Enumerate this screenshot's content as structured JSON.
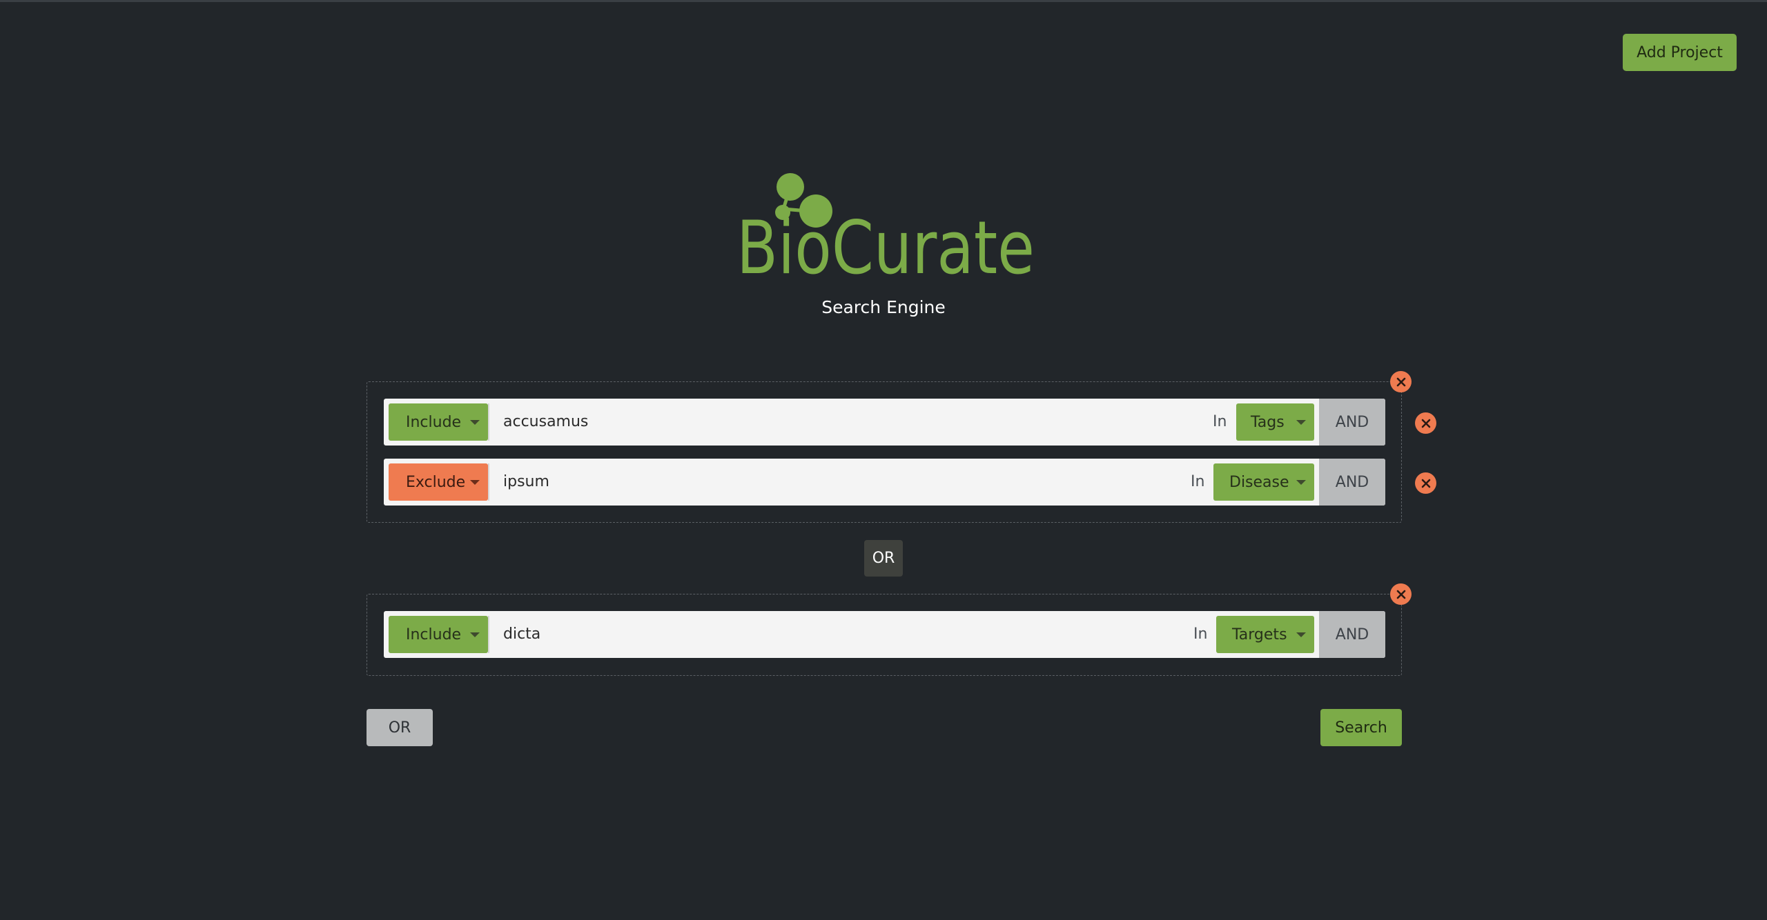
{
  "header": {
    "add_project_label": "Add Project"
  },
  "brand": {
    "name": "BioCurate",
    "subtitle": "Search Engine",
    "color": "#7cab48"
  },
  "colors": {
    "include": "#7cab48",
    "exclude": "#ef7b50",
    "background": "#22262a"
  },
  "groups": [
    {
      "rows": [
        {
          "mode": "Include",
          "term": "accusamus",
          "in_label": "In",
          "field": "Tags",
          "connector": "AND"
        },
        {
          "mode": "Exclude",
          "term": "ipsum",
          "in_label": "In",
          "field": "Disease",
          "connector": "AND"
        }
      ]
    },
    {
      "rows": [
        {
          "mode": "Include",
          "term": "dicta",
          "in_label": "In",
          "field": "Targets",
          "connector": "AND"
        }
      ]
    }
  ],
  "group_connector": "OR",
  "footer": {
    "or_label": "OR",
    "search_label": "Search"
  }
}
